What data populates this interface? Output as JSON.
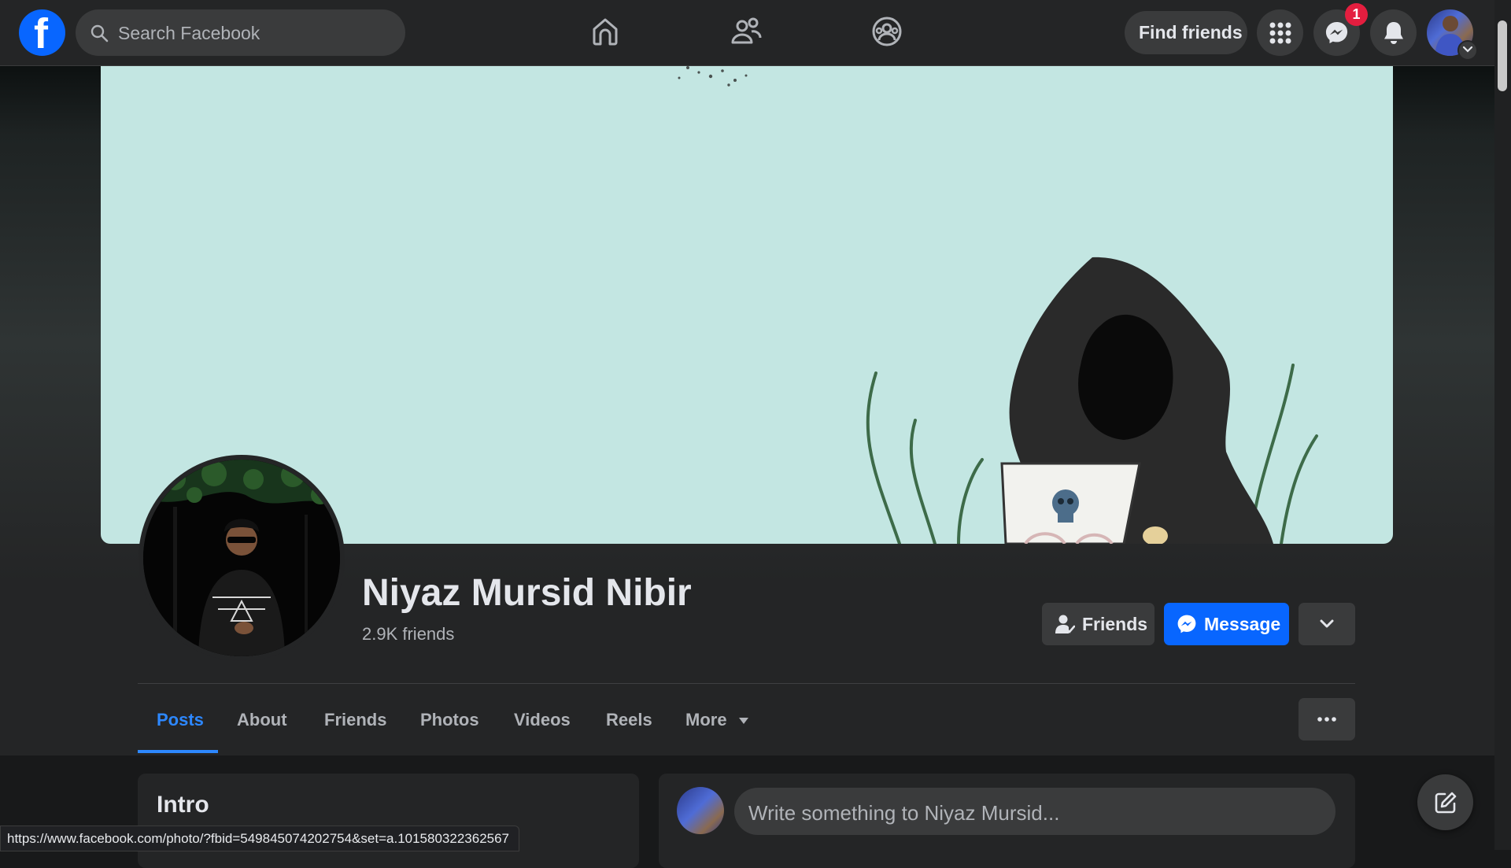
{
  "topbar": {
    "logo_letter": "f",
    "search_placeholder": "Search Facebook",
    "find_friends_label": "Find friends",
    "messenger_badge": "1",
    "icons": [
      "facebook-logo",
      "search-icon",
      "home-icon",
      "friends-icon",
      "groups-icon",
      "menu-grid-icon",
      "messenger-icon",
      "bell-icon",
      "account-avatar",
      "chevron-down-icon"
    ]
  },
  "profile": {
    "name": "Niyaz Mursid Nibir",
    "friends_count": "2.9K friends",
    "actions": {
      "friends_label": "Friends",
      "message_label": "Message"
    }
  },
  "tabs": [
    {
      "label": "Posts",
      "active": true
    },
    {
      "label": "About"
    },
    {
      "label": "Friends"
    },
    {
      "label": "Photos"
    },
    {
      "label": "Videos"
    },
    {
      "label": "Reels"
    },
    {
      "label": "More"
    }
  ],
  "intro": {
    "title": "Intro"
  },
  "composer": {
    "placeholder": "Write something to Niyaz Mursid..."
  },
  "status_bar": {
    "url": "https://www.facebook.com/photo/?fbid=549845074202754&set=a.101580322362567"
  },
  "colors": {
    "accent": "#0866ff",
    "active_tab": "#2d88ff",
    "badge": "#e41e3f",
    "cover_bg": "#c3e6e2"
  }
}
